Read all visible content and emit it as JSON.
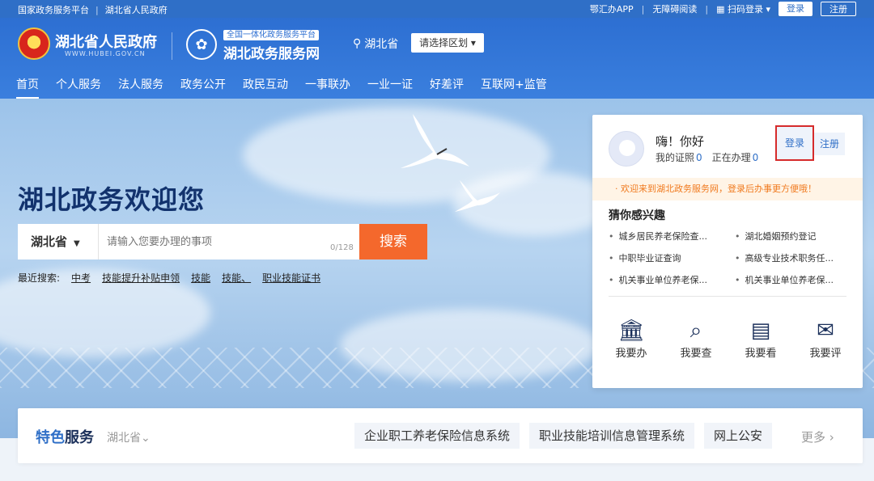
{
  "topbar": {
    "left_links": [
      "国家政务服务平台",
      "湖北省人民政府"
    ],
    "app": "鄂汇办APP",
    "accessibility": "无障碍阅读",
    "scan_login": "扫码登录",
    "login": "登录",
    "register": "注册"
  },
  "header": {
    "gov_name": "湖北省人民政府",
    "gov_sub": "WWW.HUBEI.GOV.CN",
    "svc_tag": "全国一体化政务服务平台",
    "svc_name": "湖北政务服务网",
    "location": "湖北省",
    "region_select": "请选择区划"
  },
  "nav": [
    "首页",
    "个人服务",
    "法人服务",
    "政务公开",
    "政民互动",
    "一事联办",
    "一业一证",
    "好差评",
    "互联网+监管"
  ],
  "hero": {
    "welcome": "湖北政务欢迎您",
    "search_province": "湖北省",
    "search_placeholder": "请输入您要办理的事项",
    "search_count": "0/128",
    "search_button": "搜索",
    "recent_label": "最近搜索:",
    "recent": [
      "中考",
      "技能提升补贴申领",
      "技能",
      "技能、",
      "职业技能证书"
    ]
  },
  "panel": {
    "greeting": "嗨！你好",
    "cert_label": "我的证照",
    "cert_count": "0",
    "doing_label": "正在办理",
    "doing_count": "0",
    "login": "登录",
    "register": "注册",
    "notice": "· 欢迎来到湖北政务服务网，登录后办事更方便哦！",
    "guess_title": "猜你感兴趣",
    "guess_items": [
      "城乡居民养老保险查...",
      "湖北婚姻预约登记",
      "中职毕业证查询",
      "高级专业技术职务任...",
      "机关事业单位养老保...",
      "机关事业单位养老保..."
    ],
    "actions": [
      {
        "label": "我要办",
        "icon": "bank-icon"
      },
      {
        "label": "我要查",
        "icon": "search-doc-icon"
      },
      {
        "label": "我要看",
        "icon": "doc-view-icon"
      },
      {
        "label": "我要评",
        "icon": "comment-icon"
      }
    ]
  },
  "feature": {
    "title_a": "特色",
    "title_b": "服务",
    "province": "湖北省",
    "links": [
      "企业职工养老保险信息系统",
      "职业技能培训信息管理系统",
      "网上公安"
    ],
    "more": "更多"
  },
  "colors": {
    "primary": "#2f6fc7",
    "search_button": "#f4682c",
    "notice": "#f07a1f",
    "highlight_border": "#d62b2b"
  }
}
